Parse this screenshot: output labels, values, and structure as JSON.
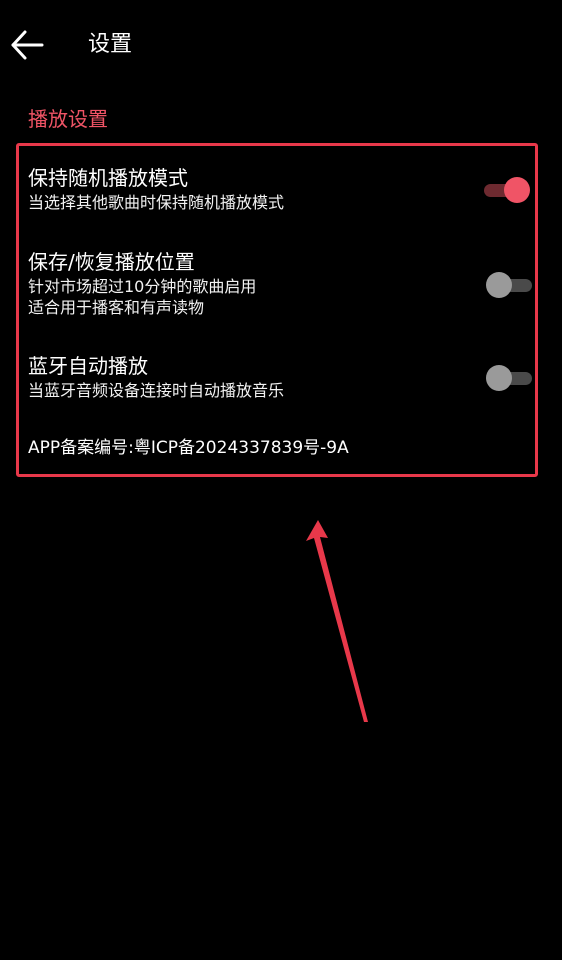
{
  "header": {
    "title": "设置"
  },
  "section": {
    "title": "播放设置"
  },
  "settings": [
    {
      "title": "保持随机播放模式",
      "desc_lines": [
        "当选择其他歌曲时保持随机播放模式"
      ],
      "toggle": "on"
    },
    {
      "title": "保存/恢复播放位置",
      "desc_lines": [
        "针对市场超过10分钟的歌曲启用",
        "适合用于播客和有声读物"
      ],
      "toggle": "off"
    },
    {
      "title": "蓝牙自动播放",
      "desc_lines": [
        "当蓝牙音频设备连接时自动播放音乐"
      ],
      "toggle": "off"
    }
  ],
  "icp": "APP备案编号:粤ICP备2024337839号-9A",
  "icons": {
    "back": "back-arrow-icon"
  },
  "colors": {
    "background": "#000000",
    "accent": "#f05466",
    "annotation": "#e8384a",
    "toggle_on_thumb": "#f05466",
    "toggle_on_track": "#6e2a30",
    "toggle_off_thumb": "#9a9a9a",
    "toggle_off_track": "#4a4a4a"
  }
}
